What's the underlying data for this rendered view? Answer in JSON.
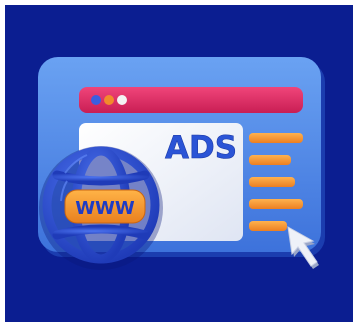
{
  "illustration": {
    "window_label": "ADS",
    "globe_label": "WWW",
    "colors": {
      "background": "#0b1e91",
      "window_frame": "#4f8be8",
      "address_bar": "#df2f63",
      "content_panel": "#f2f4fa",
      "text_lines": "#f89b36",
      "globe": "#2f55dc",
      "pill": "#f39a2c",
      "cursor": "#eef1f8"
    },
    "traffic_lights": [
      "#3b5ee0",
      "#f28a2c",
      "#f3f3f3"
    ],
    "icons": [
      "browser-window-icon",
      "globe-icon",
      "mouse-cursor-icon"
    ]
  }
}
